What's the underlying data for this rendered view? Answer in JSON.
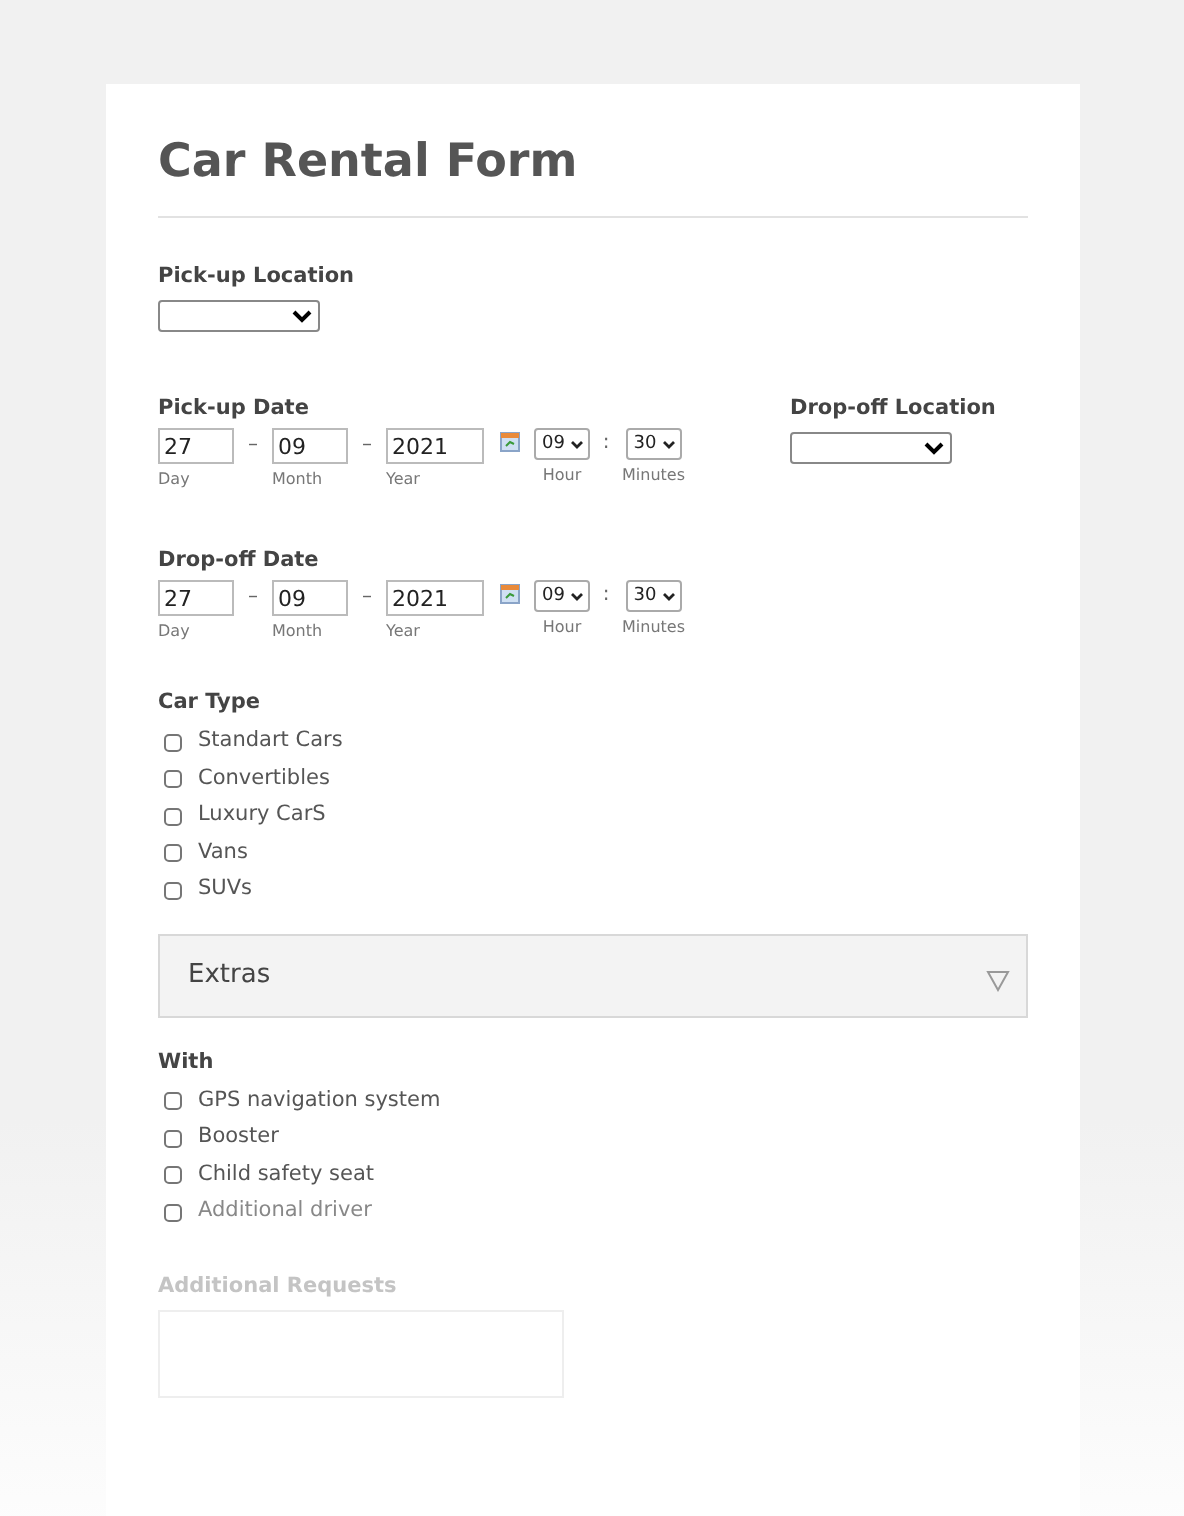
{
  "title": "Car Rental Form",
  "pickup_location": {
    "label": "Pick-up Location"
  },
  "pickup_date": {
    "label": "Pick-up Date",
    "day": "27",
    "month": "09",
    "year": "2021",
    "separators": [
      "–",
      "–"
    ],
    "day_sublabel": "Day",
    "month_sublabel": "Month",
    "year_sublabel": "Year",
    "hour": "09",
    "time_separator": ":",
    "minutes": "30",
    "hour_sublabel": "Hour",
    "minutes_sublabel": "Minutes"
  },
  "dropoff_location": {
    "label": "Drop-off Location"
  },
  "dropoff_date": {
    "label": "Drop-off Date",
    "day": "27",
    "month": "09",
    "year": "2021",
    "separators": [
      "–",
      "–"
    ],
    "day_sublabel": "Day",
    "month_sublabel": "Month",
    "year_sublabel": "Year",
    "hour": "09",
    "time_separator": ":",
    "minutes": "30",
    "hour_sublabel": "Hour",
    "minutes_sublabel": "Minutes"
  },
  "car_type": {
    "label": "Car Type",
    "options": [
      {
        "label": "Standart Cars",
        "checked": false
      },
      {
        "label": "Convertibles",
        "checked": false
      },
      {
        "label": "Luxury CarS",
        "checked": false
      },
      {
        "label": "Vans",
        "checked": false
      },
      {
        "label": "SUVs",
        "checked": false
      }
    ]
  },
  "extras": {
    "title": "Extras"
  },
  "with": {
    "label": "With",
    "options": [
      {
        "label": "GPS navigation system",
        "checked": false
      },
      {
        "label": "Booster",
        "checked": false
      },
      {
        "label": "Child safety seat",
        "checked": false
      },
      {
        "label": "Additional driver",
        "checked": false
      }
    ]
  },
  "additional_requests": {
    "label": "Additional Requests"
  }
}
